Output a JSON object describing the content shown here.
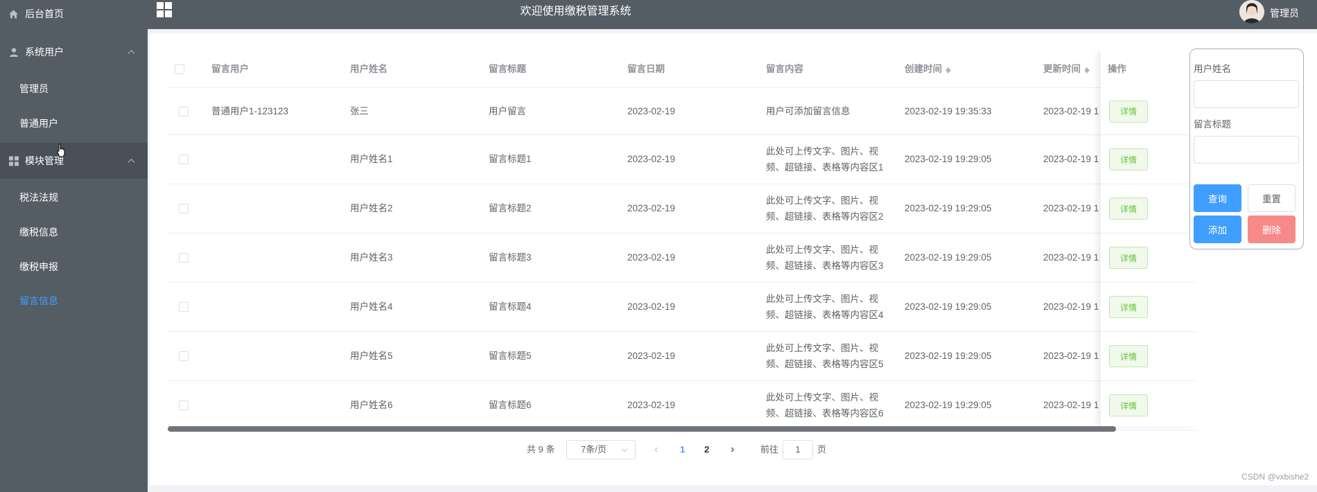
{
  "sidebar": {
    "home": {
      "label": "后台首页",
      "icon": "home-icon"
    },
    "system_users": {
      "label": "系统用户",
      "icon": "user-icon"
    },
    "admin": {
      "label": "管理员"
    },
    "normal_user": {
      "label": "普通用户"
    },
    "module_mgmt": {
      "label": "模块管理",
      "icon": "grid-icon"
    },
    "tax_law": {
      "label": "税法法规"
    },
    "tax_info": {
      "label": "缴税信息"
    },
    "tax_declare": {
      "label": "缴税申报"
    },
    "messages": {
      "label": "留言信息",
      "active_color": "#409eff"
    }
  },
  "header": {
    "title": "欢迎使用缴税管理系统",
    "user": "管理员"
  },
  "table": {
    "columns": [
      "留言用户",
      "用户姓名",
      "留言标题",
      "留言日期",
      "留言内容",
      "创建时间",
      "更新时间",
      "操作"
    ],
    "rows": [
      {
        "user": "普通用户1-123123",
        "name": "张三",
        "title": "用户留言",
        "date": "2023-02-19",
        "content1": "用户可添加留言信息",
        "content2": "",
        "created": "2023-02-19 19:35:33",
        "updated": "2023-02-19 1",
        "action": "详情"
      },
      {
        "user": "",
        "name": "用户姓名1",
        "title": "留言标题1",
        "date": "2023-02-19",
        "content1": "此处可上传文字、图片、视",
        "content2": "频、超链接、表格等内容区1",
        "created": "2023-02-19 19:29:05",
        "updated": "2023-02-19 1",
        "action": "详情"
      },
      {
        "user": "",
        "name": "用户姓名2",
        "title": "留言标题2",
        "date": "2023-02-19",
        "content1": "此处可上传文字、图片、视",
        "content2": "频、超链接、表格等内容区2",
        "created": "2023-02-19 19:29:05",
        "updated": "2023-02-19 1",
        "action": "详情"
      },
      {
        "user": "",
        "name": "用户姓名3",
        "title": "留言标题3",
        "date": "2023-02-19",
        "content1": "此处可上传文字、图片、视",
        "content2": "频、超链接、表格等内容区3",
        "created": "2023-02-19 19:29:05",
        "updated": "2023-02-19 1",
        "action": "详情"
      },
      {
        "user": "",
        "name": "用户姓名4",
        "title": "留言标题4",
        "date": "2023-02-19",
        "content1": "此处可上传文字、图片、视",
        "content2": "频、超链接、表格等内容区4",
        "created": "2023-02-19 19:29:05",
        "updated": "2023-02-19 1",
        "action": "详情"
      },
      {
        "user": "",
        "name": "用户姓名5",
        "title": "留言标题5",
        "date": "2023-02-19",
        "content1": "此处可上传文字、图片、视",
        "content2": "频、超链接、表格等内容区5",
        "created": "2023-02-19 19:29:05",
        "updated": "2023-02-19 1",
        "action": "详情"
      },
      {
        "user": "",
        "name": "用户姓名6",
        "title": "留言标题6",
        "date": "2023-02-19",
        "content1": "此处可上传文字、图片、视",
        "content2": "频、超链接、表格等内容区6",
        "created": "2023-02-19 19:29:05",
        "updated": "2023-02-19 1",
        "action": "详情"
      }
    ]
  },
  "pagination": {
    "total": "共 9 条",
    "page_size": "7条/页",
    "pages": [
      "1",
      "2"
    ],
    "current_page": "1",
    "goto_prefix": "前往",
    "goto_value": "1",
    "goto_suffix": "页"
  },
  "search": {
    "name_label": "用户姓名",
    "title_label": "留言标题",
    "query_button": "查询",
    "reset_button": "重置",
    "add_button": "添加",
    "delete_button": "删除"
  },
  "colors": {
    "sidebar_bg": "#545c64",
    "primary": "#409eff",
    "danger": "#f78989",
    "success": "#67c23a"
  },
  "watermark": "CSDN @vxbishe2"
}
